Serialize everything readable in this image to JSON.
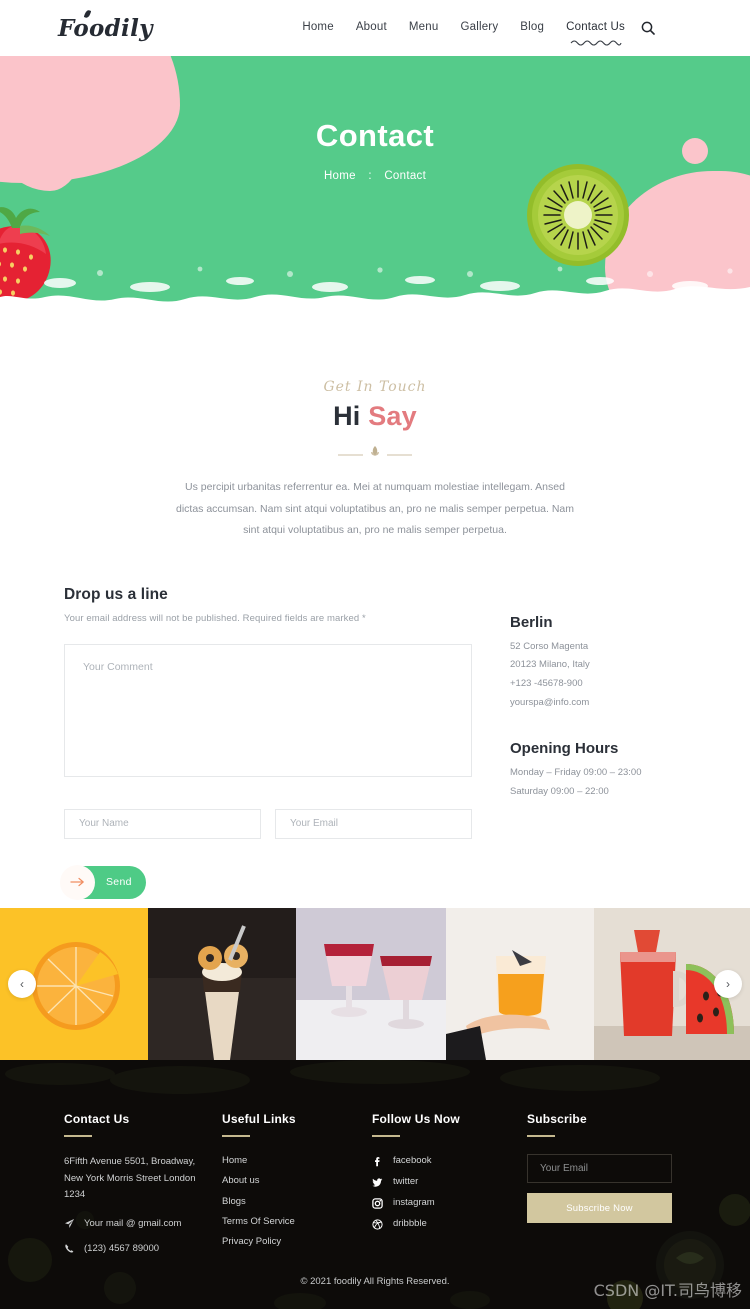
{
  "header": {
    "logo": "Foodily",
    "nav": [
      {
        "label": "Home",
        "active": false
      },
      {
        "label": "About",
        "active": false
      },
      {
        "label": "Menu",
        "active": false
      },
      {
        "label": "Gallery",
        "active": false
      },
      {
        "label": "Blog",
        "active": false
      },
      {
        "label": "Contact Us",
        "active": true
      }
    ],
    "search_icon": "search-icon",
    "menu_icon": "hamburger-menu-icon"
  },
  "hero": {
    "title": "Contact",
    "breadcrumb_home": "Home",
    "breadcrumb_sep": ":",
    "breadcrumb_current": "Contact",
    "bg_color": "#55cb8a",
    "blob_color": "#fbc5cb"
  },
  "intro": {
    "script_label": "Get In Touch",
    "title_plain": "Hi ",
    "title_accent": "Say",
    "accent_color": "#e37b7f",
    "paragraph": "Us percipit urbanitas referrentur ea. Mei at numquam molestiae intellegam. Ansed dictas accumsan. Nam sint atqui voluptatibus an, pro ne malis semper perpetua. Nam sint atqui voluptatibus an, pro ne malis semper perpetua."
  },
  "form": {
    "heading": "Drop us a line",
    "subheading": "Your email address will not be published. Required fields are marked *",
    "comment_placeholder": "Your Comment",
    "comment_value": "",
    "name_placeholder": "Your Name",
    "name_value": "",
    "email_placeholder": "Your Email",
    "email_value": "",
    "send_label": "Send",
    "send_color": "#4ecb86",
    "arrow_icon": "arrow-right-icon"
  },
  "info": {
    "city_heading": "Berlin",
    "address_lines": [
      "52 Corso Magenta",
      "20123 Milano, Italy",
      "+123 -45678-900",
      "yourspa@info.com"
    ],
    "hours_heading": "Opening Hours",
    "hours_lines": [
      "Monday – Friday 09:00 – 23:00",
      "Saturday 09:00 – 22:00"
    ]
  },
  "gallery": {
    "prev_icon": "chevron-left-icon",
    "next_icon": "chevron-right-icon",
    "items": [
      {
        "name": "orange-slice-photo",
        "bg": "#fcc227"
      },
      {
        "name": "donut-milkshake-photo",
        "bg": "#2c2623"
      },
      {
        "name": "berry-smoothie-glasses-photo",
        "bg": "#d8d3dd"
      },
      {
        "name": "orange-cocktail-in-hand-photo",
        "bg": "#f0ece9"
      },
      {
        "name": "watermelon-drink-photo",
        "bg": "#e0d9cf"
      }
    ]
  },
  "footer": {
    "contact": {
      "heading": "Contact Us",
      "address": "6Fifth Avenue 5501, Broadway, New York Morris Street London 1234",
      "mail_icon": "paper-plane-icon",
      "mail": "Your mail @ gmail.com",
      "phone_icon": "phone-icon",
      "phone": "(123) 4567 89000"
    },
    "links": {
      "heading": "Useful Links",
      "items": [
        "Home",
        "About us",
        "Blogs",
        "Terms Of Service",
        "Privacy Policy"
      ]
    },
    "social": {
      "heading": "Follow Us Now",
      "items": [
        {
          "icon": "facebook-icon",
          "label": "facebook"
        },
        {
          "icon": "twitter-icon",
          "label": "twitter"
        },
        {
          "icon": "instagram-icon",
          "label": "instagram"
        },
        {
          "icon": "dribbble-icon",
          "label": "dribbble"
        }
      ]
    },
    "subscribe": {
      "heading": "Subscribe",
      "email_placeholder": "Your Email",
      "email_value": "",
      "button_label": "Subscribe Now",
      "button_color": "#d2c79f"
    },
    "copyright": "© 2021 foodily All Rights Reserved.",
    "accent_color": "#c5b98f"
  },
  "watermark": "CSDN @IT.司鸟博移"
}
